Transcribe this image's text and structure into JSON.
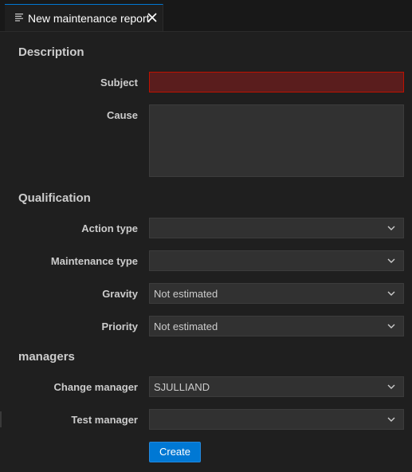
{
  "tab": {
    "title": "New maintenance report",
    "icon": "document-lines-icon",
    "close_icon": "close-icon"
  },
  "sections": {
    "description": "Description",
    "qualification": "Qualification",
    "managers": "managers"
  },
  "fields": {
    "subject": {
      "label": "Subject",
      "value": ""
    },
    "cause": {
      "label": "Cause",
      "value": ""
    },
    "action_type": {
      "label": "Action type",
      "value": ""
    },
    "maintenance_type": {
      "label": "Maintenance type",
      "value": ""
    },
    "gravity": {
      "label": "Gravity",
      "value": "Not estimated"
    },
    "priority": {
      "label": "Priority",
      "value": "Not estimated"
    },
    "change_manager": {
      "label": "Change manager",
      "value": "SJULLIAND"
    },
    "test_manager": {
      "label": "Test manager",
      "value": ""
    }
  },
  "actions": {
    "create_label": "Create"
  },
  "colors": {
    "background": "#1f1f1f",
    "accent": "#0078d4",
    "invalid_background": "#5a1d1d",
    "invalid_border": "#be1100"
  }
}
